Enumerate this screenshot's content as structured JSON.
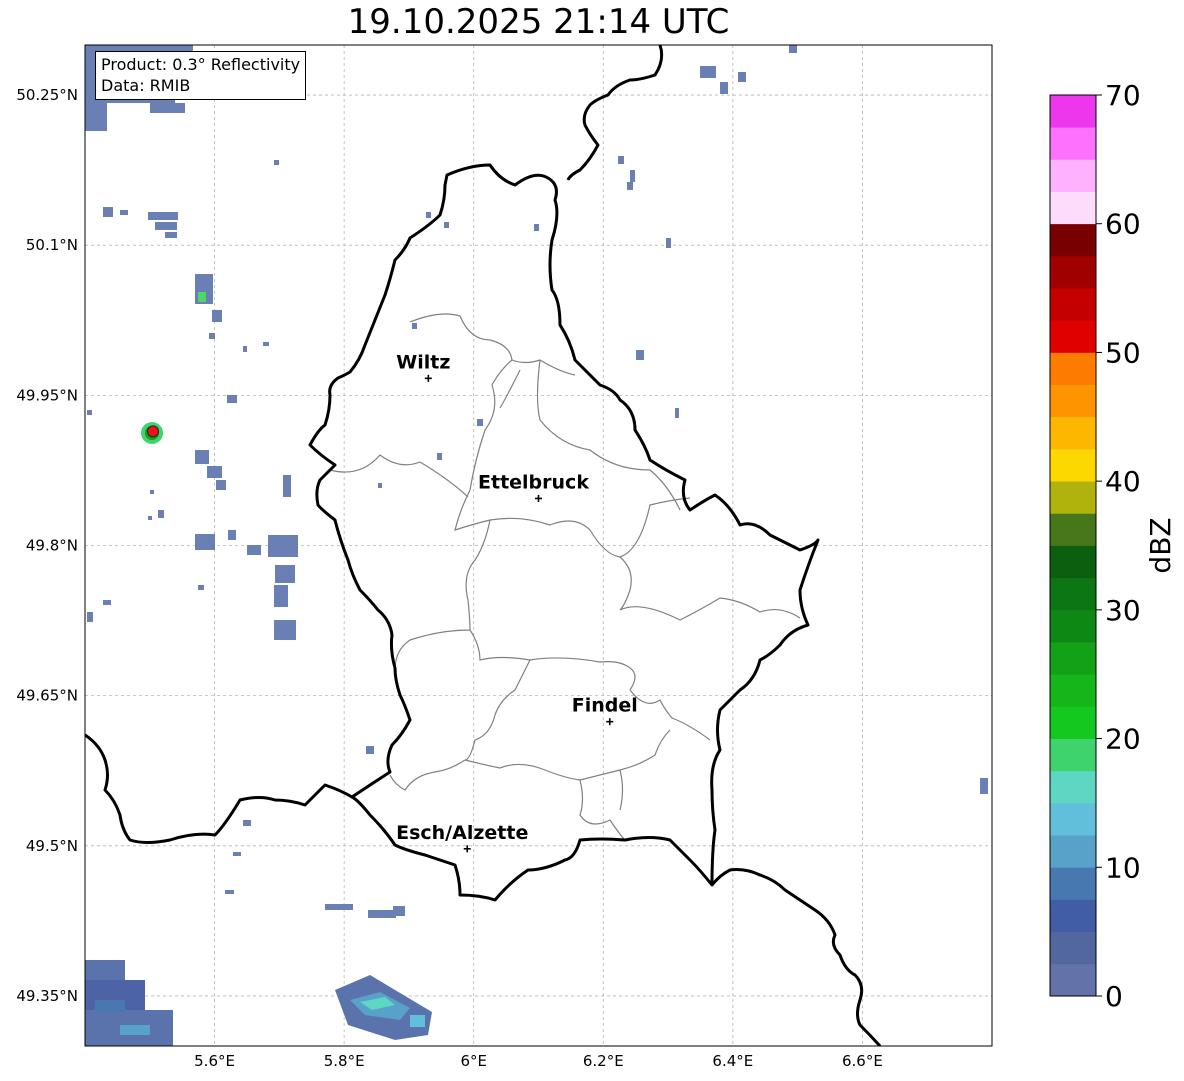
{
  "title": "19.10.2025 21:14 UTC",
  "info": {
    "product": "Product: 0.3° Reflectivity",
    "data": "Data: RMIB"
  },
  "map": {
    "lon_range": [
      5.4,
      6.8
    ],
    "lat_range": [
      49.3,
      50.3
    ],
    "lon_ticks": [
      {
        "value": 5.6,
        "label": "5.6°E"
      },
      {
        "value": 5.8,
        "label": "5.8°E"
      },
      {
        "value": 6.0,
        "label": "6°E"
      },
      {
        "value": 6.2,
        "label": "6.2°E"
      },
      {
        "value": 6.4,
        "label": "6.4°E"
      },
      {
        "value": 6.6,
        "label": "6.6°E"
      }
    ],
    "lat_ticks": [
      {
        "value": 50.25,
        "label": "50.25°N"
      },
      {
        "value": 50.1,
        "label": "50.1°N"
      },
      {
        "value": 49.95,
        "label": "49.95°N"
      },
      {
        "value": 49.8,
        "label": "49.8°N"
      },
      {
        "value": 49.65,
        "label": "49.65°N"
      },
      {
        "value": 49.5,
        "label": "49.5°N"
      },
      {
        "value": 49.35,
        "label": "49.35°N"
      }
    ],
    "cities": [
      {
        "name": "Wiltz",
        "lon": 5.93,
        "lat": 49.967
      },
      {
        "name": "Ettelbruck",
        "lon": 6.1,
        "lat": 49.847
      },
      {
        "name": "Findel",
        "lon": 6.21,
        "lat": 49.624
      },
      {
        "name": "Esch/Alzette",
        "lon": 5.99,
        "lat": 49.497
      }
    ],
    "radar_site": {
      "lon": 5.505,
      "lat": 49.914,
      "color": "#e8141a"
    }
  },
  "colorbar": {
    "label": "dBZ",
    "min": 0,
    "max": 70,
    "ticks": [
      0,
      10,
      20,
      30,
      40,
      50,
      60,
      70
    ],
    "colors": [
      "#6372a8",
      "#53679f",
      "#415da3",
      "#4779b0",
      "#58a1c9",
      "#61bfdb",
      "#5dd6c3",
      "#3fd36e",
      "#13c81e",
      "#14b61a",
      "#13a117",
      "#0e8814",
      "#0c7615",
      "#0b5f0e",
      "#48761a",
      "#b0b30c",
      "#fdd700",
      "#fdb700",
      "#fd9400",
      "#fd7c00",
      "#e00000",
      "#c40000",
      "#a00000",
      "#780000",
      "#fbdcfb",
      "#fdb2fd",
      "#fd72fd",
      "#ec37ec"
    ]
  }
}
